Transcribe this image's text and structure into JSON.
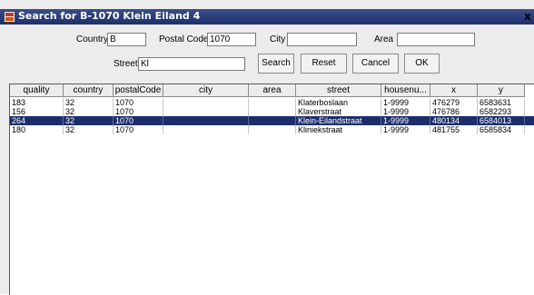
{
  "window": {
    "title": "Search for B-1070 Klein Eiland 4",
    "close_label": "x"
  },
  "form": {
    "country_label": "Country",
    "country_value": "B",
    "postal_label": "Postal Code",
    "postal_value": "1070",
    "city_label": "City",
    "city_value": "",
    "area_label": "Area",
    "area_value": "",
    "street_label": "Street",
    "street_value": "Kl"
  },
  "buttons": {
    "search": "Search",
    "reset": "Reset",
    "cancel": "Cancel",
    "ok": "OK"
  },
  "table": {
    "columns": [
      "quality",
      "country",
      "postalCode",
      "city",
      "area",
      "street",
      "housenu...",
      "x",
      "y"
    ],
    "rows": [
      [
        "183",
        "32",
        "1070",
        "",
        "",
        "Klaterboslaan",
        "1-9999",
        "476279",
        "6583631"
      ],
      [
        "156",
        "32",
        "1070",
        "",
        "",
        "Klaverstraat",
        "1-9999",
        "476786",
        "6582293"
      ],
      [
        "264",
        "32",
        "1070",
        "",
        "",
        "Klein-Eilandstraat",
        "1-9999",
        "480134",
        "6584013"
      ],
      [
        "180",
        "32",
        "1070",
        "",
        "",
        "Kliniekstraat",
        "1-9999",
        "481755",
        "6585834"
      ]
    ],
    "selected_index": 2
  },
  "colors": {
    "titlebar": "#2a3b78",
    "selection": "#1c2d6b"
  }
}
